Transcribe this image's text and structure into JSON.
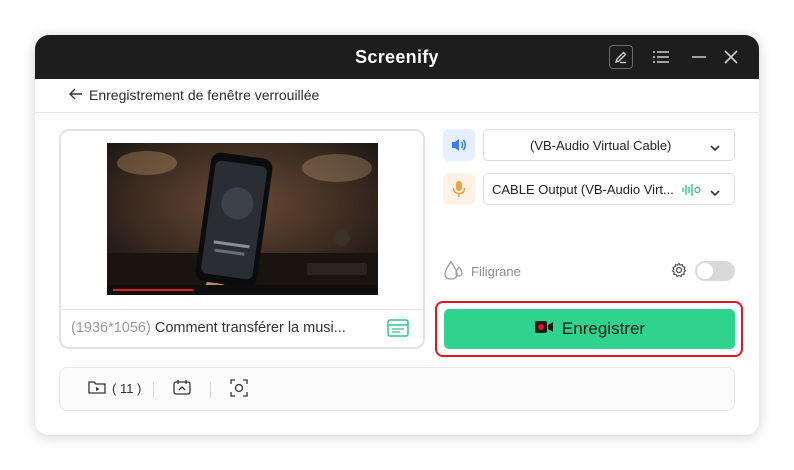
{
  "app": {
    "title": "Screenify"
  },
  "titlebar": {
    "icons": [
      "edit-icon",
      "menu-icon",
      "minimize-icon",
      "close-icon"
    ]
  },
  "nav": {
    "back_label": "Enregistrement de fenêtre verrouillée"
  },
  "preview": {
    "resolution": "(1936*1056)",
    "window_title": "Comment transférer la musi..."
  },
  "audio": {
    "speaker_device": "(VB-Audio Virtual Cable)",
    "mic_device": "CABLE Output (VB-Audio Virt..."
  },
  "watermark": {
    "label": "Filigrane",
    "enabled": false
  },
  "record": {
    "label": "Enregistrer"
  },
  "bottombar": {
    "files_count": "( 11 )"
  },
  "colors": {
    "accent_green": "#2fd38e",
    "highlight_red": "#e0161e",
    "speaker_blue": "#3b7de8",
    "mic_orange": "#f0a040"
  }
}
